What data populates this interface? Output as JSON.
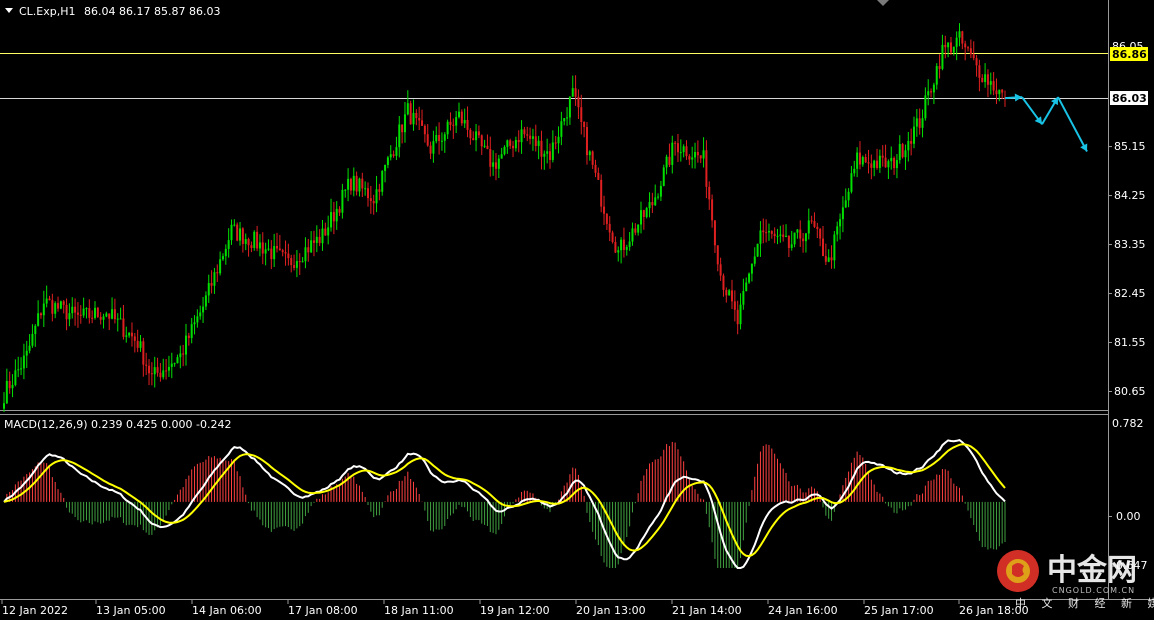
{
  "header": {
    "symbol": "CL.Exp,H1",
    "ohlc": "86.04 86.17 85.87 86.03",
    "macd_label": "MACD(12,26,9) 0.239 0.425 0.000 -0.242"
  },
  "price_axis": {
    "ticks": [
      "86.86",
      "86.03",
      "85.15",
      "84.25",
      "83.35",
      "82.45",
      "81.55",
      "80.65"
    ],
    "tick_values": [
      86.86,
      86.03,
      85.15,
      84.25,
      83.35,
      82.45,
      81.55,
      80.65
    ],
    "overlap_label": "86.05",
    "badge_highlight": "86.86",
    "badge_current": "86.03"
  },
  "macd_axis": {
    "ticks": [
      "0.782",
      "0.00",
      "-0.647"
    ],
    "tick_values": [
      0.782,
      0.0,
      -0.647
    ]
  },
  "time_axis": {
    "labels": [
      "12 Jan 2022",
      "13 Jan 05:00",
      "14 Jan 06:00",
      "17 Jan 08:00",
      "18 Jan 11:00",
      "19 Jan 12:00",
      "20 Jan 13:00",
      "21 Jan 14:00",
      "24 Jan 16:00",
      "25 Jan 17:00",
      "26 Jan 18:00"
    ]
  },
  "watermark": {
    "name": "中金网",
    "domain": "CNGOLD.COM.CN",
    "tagline": "中 文 财 经 新 媒 体"
  },
  "colors": {
    "background": "#000000",
    "bull_candle": "#00e000",
    "bear_candle": "#e02020",
    "horizontal_line_1": "#ffff60",
    "horizontal_line_2": "#d0d0d0",
    "macd_line": "#ffffff",
    "signal_line": "#ffff00",
    "hist_pos": "#ff4040",
    "hist_neg": "#40a040",
    "forecast_arrow": "#19c3e6",
    "badge_highlight_bg": "#ffff00",
    "watermark_logo": "#e8342a"
  },
  "chart_data": {
    "type": "candlestick",
    "symbol": "CL.Exp",
    "timeframe": "H1",
    "last_ohlc": {
      "open": 86.04,
      "high": 86.17,
      "low": 85.87,
      "close": 86.03
    },
    "price_range": [
      80.3,
      87.7
    ],
    "horizontal_levels": [
      86.86,
      86.03
    ],
    "price_path": [
      {
        "t": 0,
        "p": 80.6
      },
      {
        "t": 8,
        "p": 81.3
      },
      {
        "t": 14,
        "p": 82.3
      },
      {
        "t": 26,
        "p": 82.0
      },
      {
        "t": 36,
        "p": 82.1
      },
      {
        "t": 47,
        "p": 81.55
      },
      {
        "t": 52,
        "p": 80.9
      },
      {
        "t": 62,
        "p": 81.3
      },
      {
        "t": 70,
        "p": 82.2
      },
      {
        "t": 80,
        "p": 83.6
      },
      {
        "t": 88,
        "p": 83.4
      },
      {
        "t": 100,
        "p": 83.0
      },
      {
        "t": 112,
        "p": 83.5
      },
      {
        "t": 122,
        "p": 84.5
      },
      {
        "t": 130,
        "p": 84.2
      },
      {
        "t": 142,
        "p": 85.8
      },
      {
        "t": 150,
        "p": 85.1
      },
      {
        "t": 160,
        "p": 85.7
      },
      {
        "t": 172,
        "p": 84.8
      },
      {
        "t": 182,
        "p": 85.4
      },
      {
        "t": 192,
        "p": 85.0
      },
      {
        "t": 200,
        "p": 86.1
      },
      {
        "t": 210,
        "p": 84.2
      },
      {
        "t": 216,
        "p": 83.2
      },
      {
        "t": 228,
        "p": 84.1
      },
      {
        "t": 236,
        "p": 85.2
      },
      {
        "t": 246,
        "p": 84.9
      },
      {
        "t": 252,
        "p": 82.8
      },
      {
        "t": 258,
        "p": 81.9
      },
      {
        "t": 266,
        "p": 83.6
      },
      {
        "t": 276,
        "p": 83.3
      },
      {
        "t": 284,
        "p": 83.7
      },
      {
        "t": 290,
        "p": 83.0
      },
      {
        "t": 300,
        "p": 84.9
      },
      {
        "t": 312,
        "p": 84.8
      },
      {
        "t": 322,
        "p": 85.6
      },
      {
        "t": 330,
        "p": 86.9
      },
      {
        "t": 336,
        "p": 87.1
      },
      {
        "t": 342,
        "p": 86.6
      },
      {
        "t": 352,
        "p": 86.03
      }
    ],
    "macd": {
      "params": [
        12,
        26,
        9
      ],
      "main": 0.239,
      "signal": 0.425,
      "diff_a": 0.0,
      "diff_b": -0.242,
      "range": [
        -0.647,
        0.782
      ]
    },
    "forecast_path": [
      86.03,
      86.05,
      85.55,
      86.05,
      85.05
    ],
    "time_labels": [
      "12 Jan 2022",
      "13 Jan 05:00",
      "14 Jan 06:00",
      "17 Jan 08:00",
      "18 Jan 11:00",
      "19 Jan 12:00",
      "20 Jan 13:00",
      "21 Jan 14:00",
      "24 Jan 16:00",
      "25 Jan 17:00",
      "26 Jan 18:00"
    ]
  }
}
